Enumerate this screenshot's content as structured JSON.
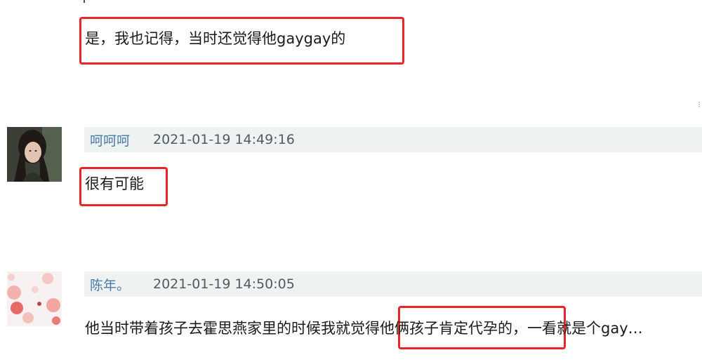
{
  "comments": [
    {
      "text": "是，我也记得，当时还觉得他gaygay的"
    },
    {
      "username": "呵呵呵",
      "timestamp": "2021-01-19 14:49:16",
      "text": "很有可能",
      "avatar": "avatar-photo-woman"
    },
    {
      "username": "陈年。",
      "timestamp": "2021-01-19 14:50:05",
      "text_before": "他当时带着孩子去霍思燕家里的时候我就觉得",
      "text_highlight": "他俩孩子肯定代孕的，",
      "text_after": "一看就是个gay…",
      "avatar": "avatar-pink-flowers"
    }
  ],
  "colors": {
    "highlight_border": "#e8262a",
    "meta_bar_bg": "#eef3f1",
    "username": "#4a7aa8"
  }
}
